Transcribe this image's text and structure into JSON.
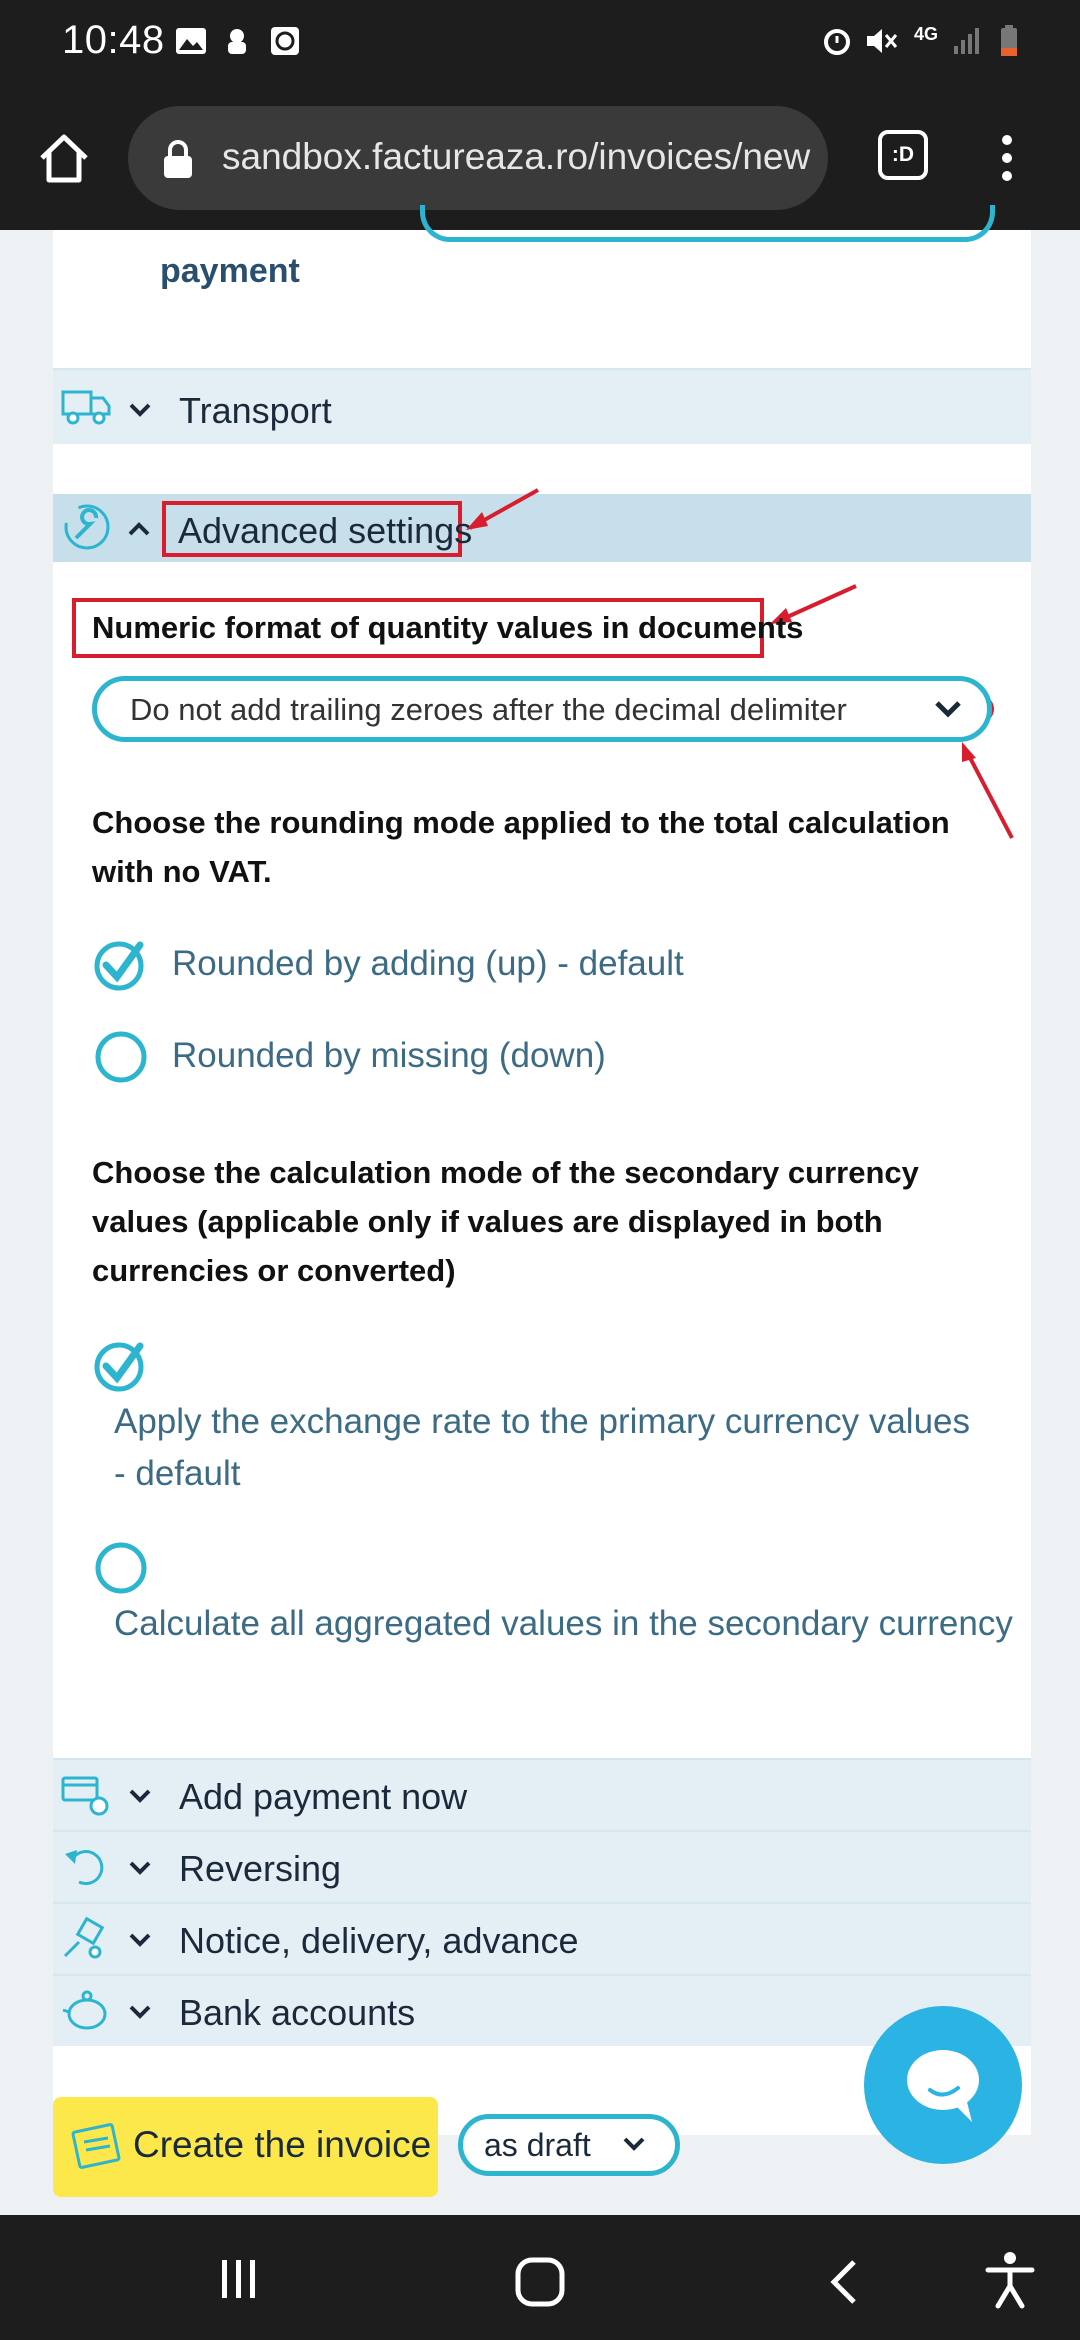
{
  "status_bar": {
    "time": "10:48",
    "icons": [
      "image-icon",
      "app-icon",
      "clock-app-icon",
      "alarm-icon",
      "mute-icon",
      "network-4g-icon",
      "signal-icon",
      "battery-icon"
    ],
    "network_label": "4G"
  },
  "browser": {
    "url": "sandbox.factureaza.ro/invoices/new",
    "tab_switcher_label": ":D"
  },
  "top_partial": {
    "payment_label": "payment"
  },
  "sections": {
    "transport": "Transport",
    "advanced_settings": "Advanced settings",
    "add_payment": "Add payment now",
    "reversing": "Reversing",
    "notice": "Notice, delivery, advance",
    "bank_accounts": "Bank accounts"
  },
  "advanced": {
    "numeric_format_label": "Numeric format of quantity values in documents",
    "numeric_format_value": "Do not add trailing zeroes after the decimal delimiter",
    "rounding_question": "Choose the rounding mode applied to the total calculation with no VAT.",
    "rounding_options": [
      {
        "label": "Rounded by adding (up) - default",
        "checked": true
      },
      {
        "label": "Rounded by missing (down)",
        "checked": false
      }
    ],
    "currency_question": "Choose the calculation mode of the secondary currency values (applicable only if values are displayed in both currencies or converted)",
    "currency_options": [
      {
        "label": "Apply the exchange rate to the primary currency values - default",
        "checked": true
      },
      {
        "label": "Calculate all aggregated values in the secondary currency",
        "checked": false
      }
    ]
  },
  "actions": {
    "create_invoice": "Create the invoice",
    "draft_select": "as draft"
  },
  "colors": {
    "accent": "#2db5d0",
    "annotation_red": "#d81e2e",
    "create_button": "#fce84a",
    "chat_button": "#2bb4e3"
  }
}
